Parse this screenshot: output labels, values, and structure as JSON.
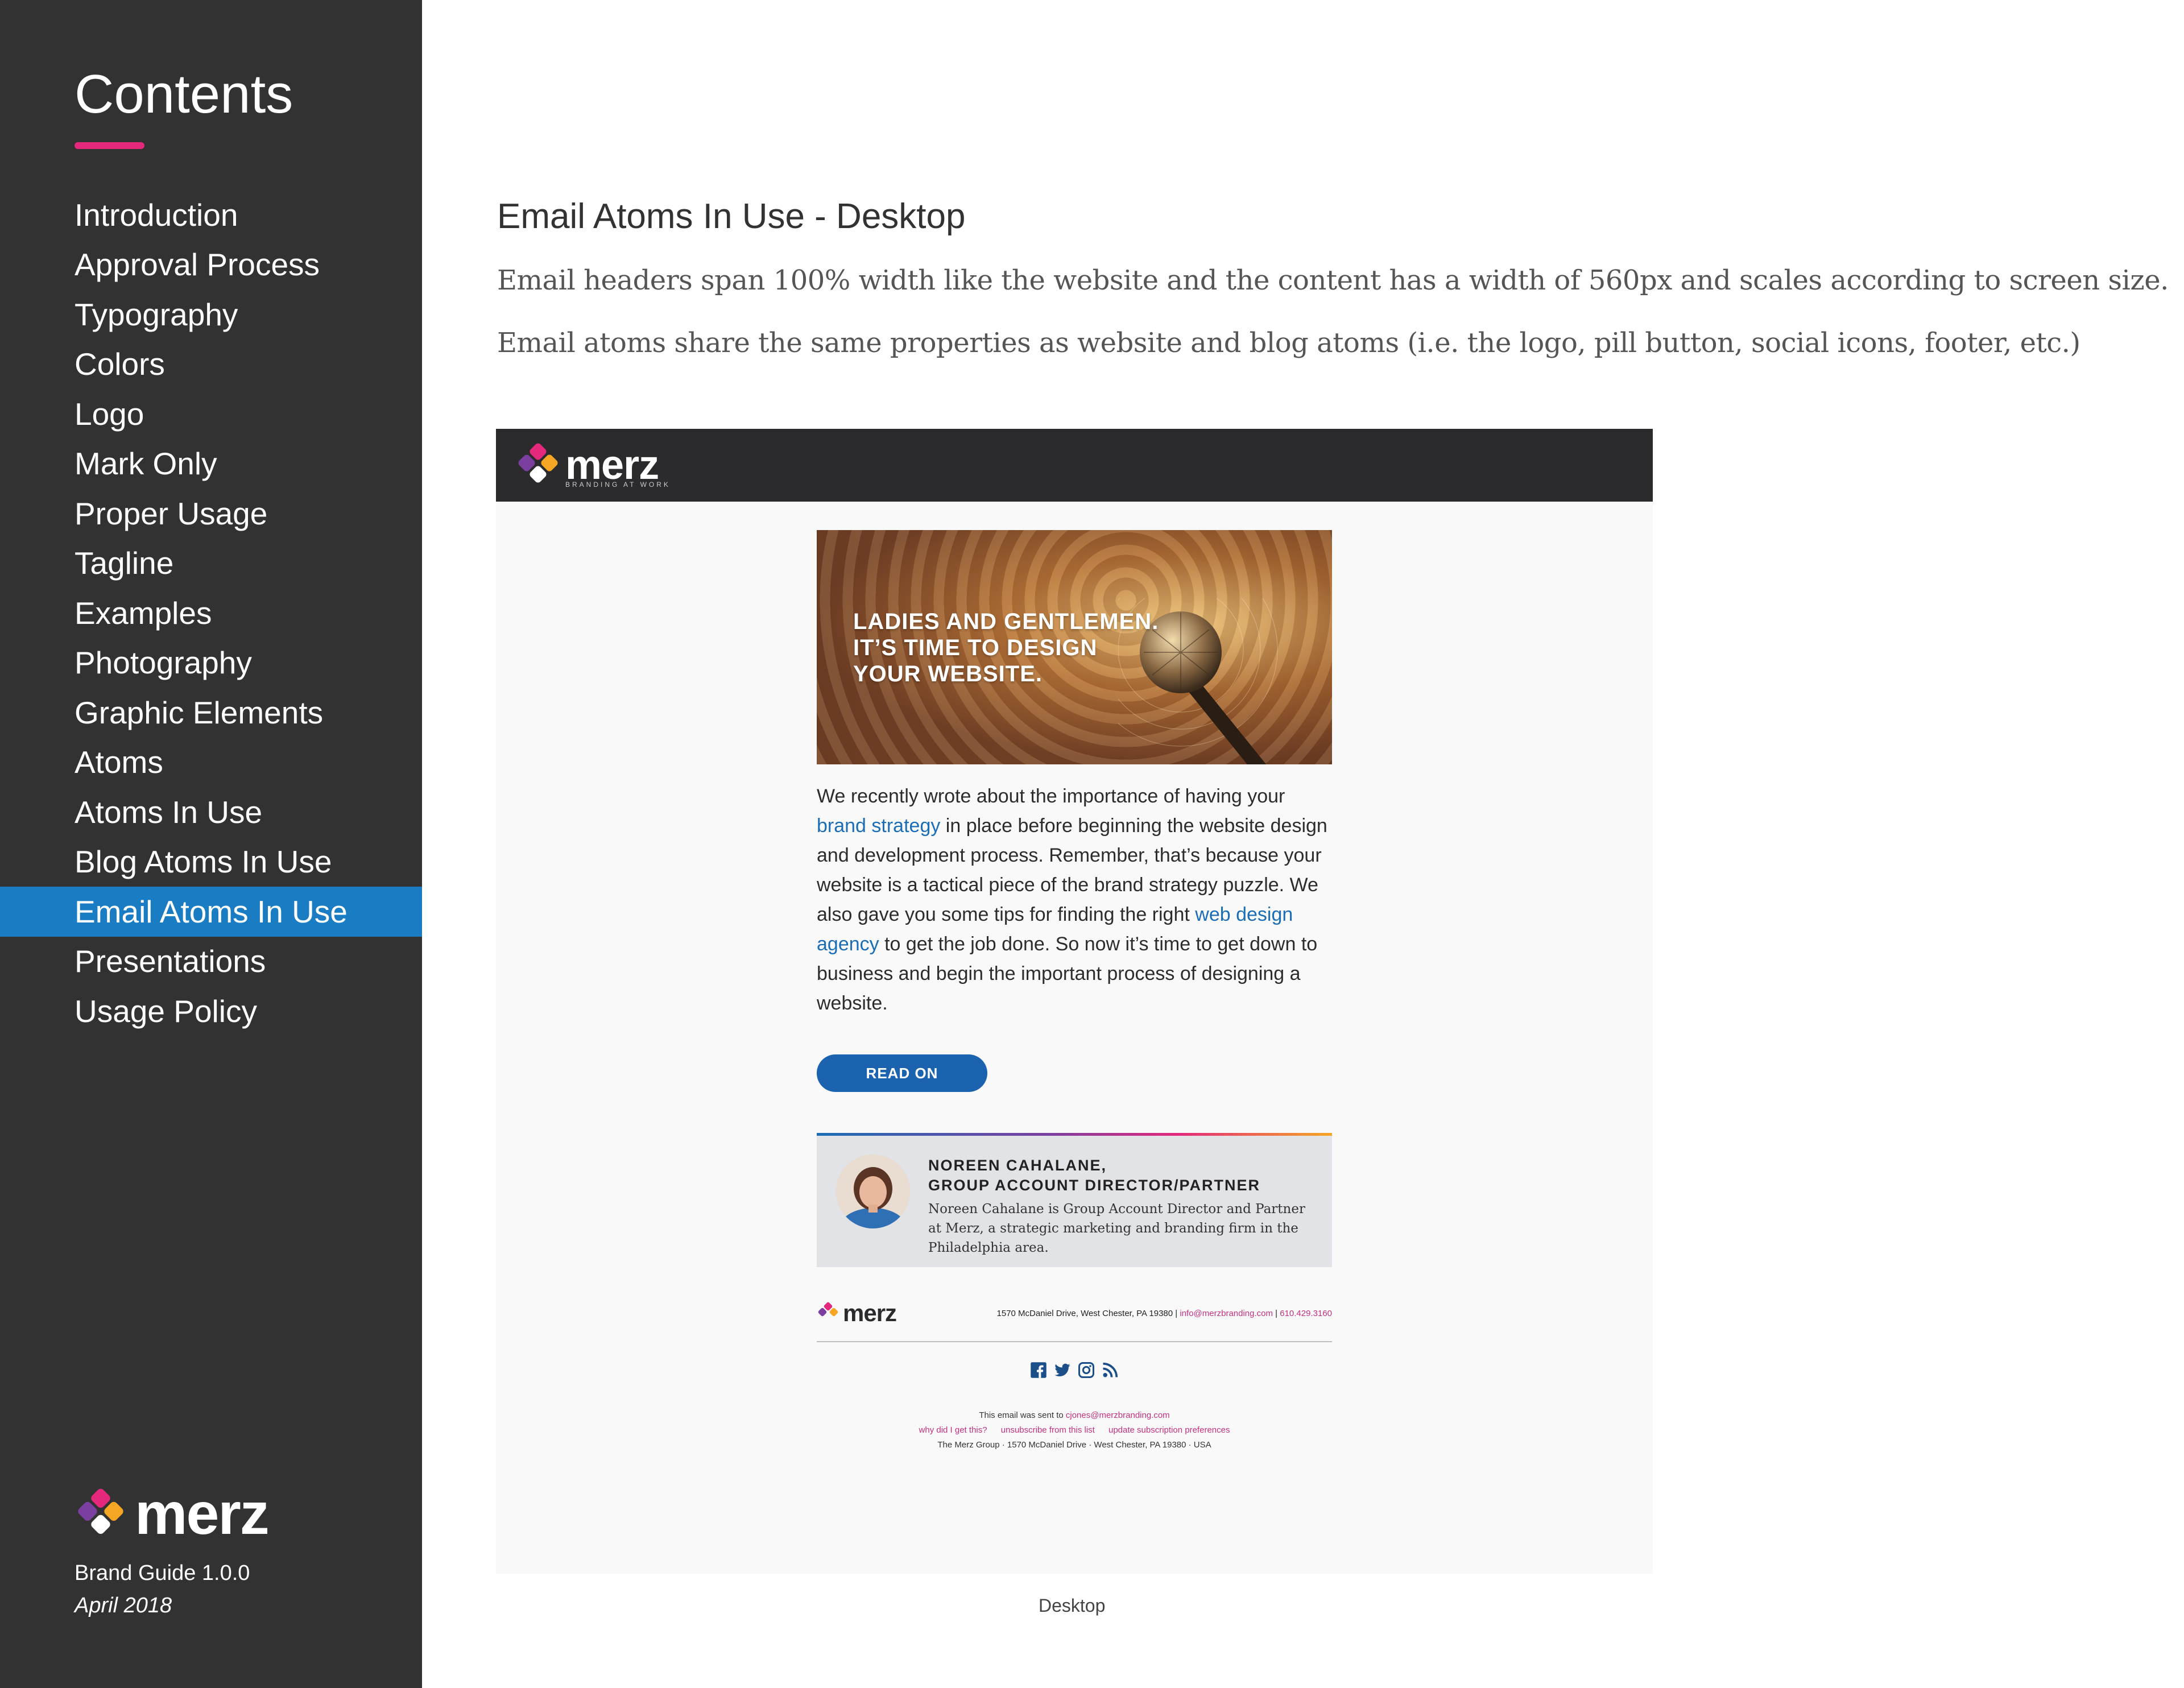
{
  "sidebar": {
    "title": "Contents",
    "items": [
      {
        "label": "Introduction"
      },
      {
        "label": "Approval Process"
      },
      {
        "label": "Typography"
      },
      {
        "label": "Colors"
      },
      {
        "label": "Logo"
      },
      {
        "label": "Mark Only"
      },
      {
        "label": "Proper Usage"
      },
      {
        "label": "Tagline"
      },
      {
        "label": "Examples"
      },
      {
        "label": "Photography"
      },
      {
        "label": "Graphic Elements"
      },
      {
        "label": "Atoms"
      },
      {
        "label": "Atoms In Use"
      },
      {
        "label": "Blog Atoms In Use"
      },
      {
        "label": "Email Atoms In Use",
        "active": true
      },
      {
        "label": "Presentations"
      },
      {
        "label": "Usage Policy"
      }
    ],
    "logo_word": "merz",
    "version": "Brand Guide 1.0.0",
    "date": "April 2018"
  },
  "main": {
    "heading": "Email Atoms In Use - Desktop",
    "desc1": "Email headers span 100% width like the website and the content has a width of 560px and scales according to screen size.",
    "desc2": "Email atoms share the same properties as website and blog atoms (i.e. the logo, pill button, social icons, footer, etc.)",
    "caption": "Desktop"
  },
  "email": {
    "header_logo_word": "merz",
    "header_tagline": "BRANDING AT WORK",
    "hero_lines": [
      "LADIES AND GENTLEMEN.",
      "IT’S TIME TO DESIGN",
      "YOUR WEBSITE."
    ],
    "body": {
      "p1": "We recently wrote about the importance of having your ",
      "link1": "brand strategy",
      "p2": " in place before beginning the website design and development process. Remember, that’s because your website is a tactical piece of the brand strategy puzzle. We also gave you some tips for finding the right ",
      "link2": "web design agency",
      "p3": " to get the job done. So now it’s time to get down to business and begin the important process of designing a website."
    },
    "cta": "READ ON",
    "author": {
      "name_line1": "NOREEN CAHALANE,",
      "name_line2": "GROUP ACCOUNT DIRECTOR/PARTNER",
      "bio": "Noreen Cahalane is Group Account Director and Partner at Merz, a strategic marketing and branding firm in the Philadelphia area."
    },
    "footer": {
      "logo_word": "merz",
      "address": "1570 McDaniel Drive, West Chester, PA 19380 | ",
      "email": "info@merzbranding.com",
      "sep": " | ",
      "phone": "610.429.3160",
      "sent_to_prefix": "This email was sent to ",
      "sent_to_email": "cjones@merzbranding.com",
      "link_why": "why did I get this?",
      "link_unsub": "unsubscribe from this list",
      "link_prefs": "update subscription preferences",
      "org_line": "The Merz Group · 1570 McDaniel Drive · West Chester, PA 19380 · USA"
    },
    "social_icons": [
      "facebook-icon",
      "twitter-icon",
      "instagram-icon",
      "rss-icon"
    ]
  },
  "colors": {
    "sidebar_bg": "#333233",
    "active_nav": "#1a7dc3",
    "accent_pink": "#e4287c",
    "link_blue": "#1b6eb6",
    "button_blue": "#1b63ae"
  }
}
